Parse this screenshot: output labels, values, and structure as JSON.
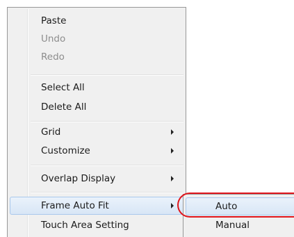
{
  "context_menu": {
    "items": [
      {
        "label": "Paste",
        "enabled": true,
        "has_submenu": false
      },
      {
        "label": "Undo",
        "enabled": false,
        "has_submenu": false
      },
      {
        "label": "Redo",
        "enabled": false,
        "has_submenu": false
      },
      {
        "label": "Select All",
        "enabled": true,
        "has_submenu": false
      },
      {
        "label": "Delete All",
        "enabled": true,
        "has_submenu": false
      },
      {
        "label": "Grid",
        "enabled": true,
        "has_submenu": true
      },
      {
        "label": "Customize",
        "enabled": true,
        "has_submenu": true
      },
      {
        "label": "Overlap Display",
        "enabled": true,
        "has_submenu": true
      },
      {
        "label": "Frame Auto Fit",
        "enabled": true,
        "has_submenu": true,
        "highlighted": true
      },
      {
        "label": "Touch Area Setting",
        "enabled": true,
        "has_submenu": false
      }
    ]
  },
  "submenu": {
    "parent": "Frame Auto Fit",
    "items": [
      {
        "label": "Auto",
        "highlighted": true
      },
      {
        "label": "Manual"
      }
    ]
  },
  "colors": {
    "menu_background": "#f0f0f0",
    "highlight": "#d8e6f6",
    "callout_border": "#e0151b",
    "disabled_text": "#8d8d8d"
  }
}
